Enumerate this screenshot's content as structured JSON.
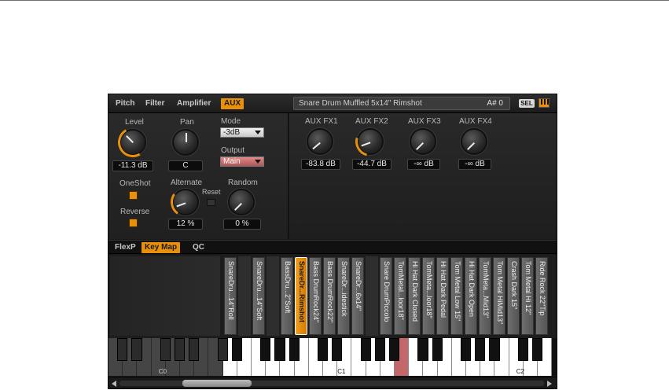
{
  "header": {
    "tabs": [
      "Pitch",
      "Filter",
      "Amplifier",
      "AUX"
    ],
    "preset_name": "Snare Drum Muffled 5x14\" Rimshot",
    "note": "A# 0",
    "sel_label": "SEL"
  },
  "left_panel": {
    "level_label": "Level",
    "level_value": "-11.3 dB",
    "pan_label": "Pan",
    "pan_value": "C",
    "mode_label": "Mode",
    "mode_value": "-3dB",
    "output_label": "Output",
    "output_value": "Main",
    "oneshot_label": "OneShot",
    "reverse_label": "Reverse",
    "alternate_label": "Alternate",
    "alternate_value": "12 %",
    "reset_label": "Reset",
    "random_label": "Random",
    "random_value": "0 %"
  },
  "right_panel": {
    "fx": [
      {
        "label": "AUX FX1",
        "value": "-83.8 dB"
      },
      {
        "label": "AUX FX2",
        "value": "-44.7 dB"
      },
      {
        "label": "AUX FX3",
        "value": "-∞ dB"
      },
      {
        "label": "AUX FX4",
        "value": "-∞ dB"
      }
    ]
  },
  "keymap": {
    "tabs": [
      "FlexP",
      "Key Map",
      "QC"
    ],
    "samples": [
      "SnareDru...14\"Roll",
      "SnareDru...14\"Soft",
      "BassDru...2\"Soft",
      "SnareDr...Rimshot",
      "Bass DrumRock24\"",
      "Bass DrumRock22\"",
      "SnareDr...idestick",
      "SnareDr...6x14\"",
      "Snare DrumPiccolo",
      "TomMetal...loor18\"",
      "Hi Hat Dark Closed",
      "TomMeta...loor18\"",
      "Hi Hat Dark Pedal",
      "Tom Metal Low 15\"",
      "Hi Hat Dark Open",
      "TomMeta...Mid13\"",
      "Tom Metal HiMid13\"",
      "Crash Dark 15\"",
      "Tom Metal Hi 12\"",
      "Ride Rock 22\"Tip"
    ],
    "octaves": [
      "C0",
      "C1",
      "C2"
    ]
  },
  "colors": {
    "accent": "#e8900a",
    "output_red": "#c06a6a",
    "pressed_key": "#c4676b"
  }
}
